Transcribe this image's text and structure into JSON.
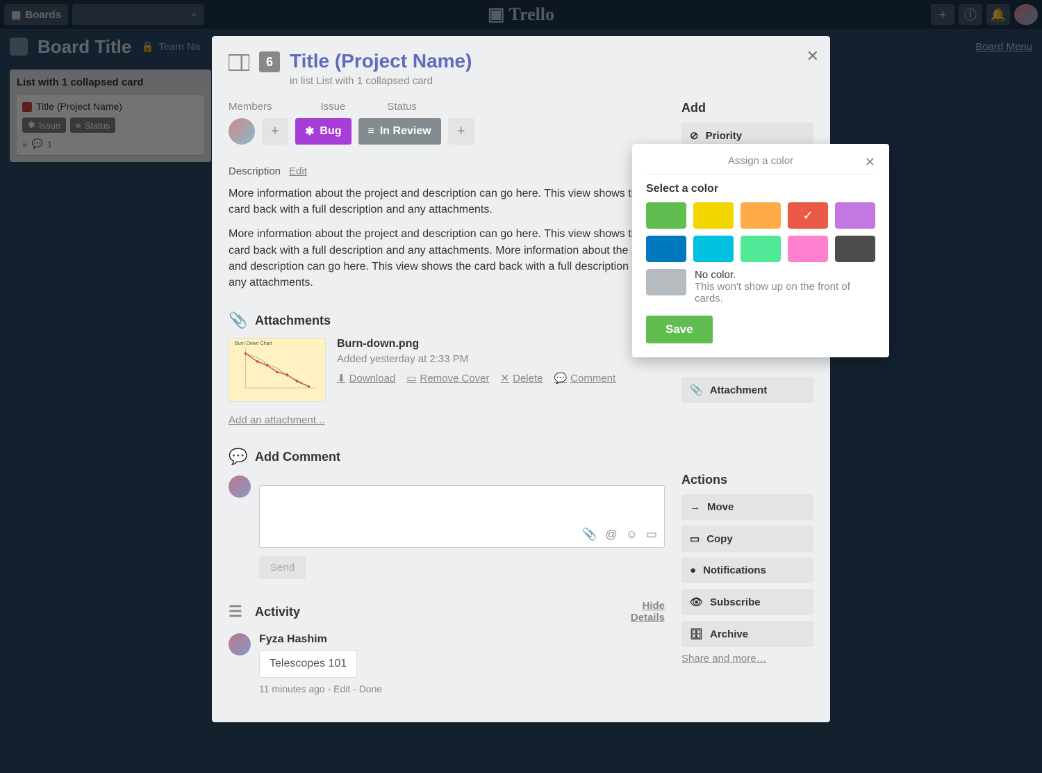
{
  "header": {
    "boards": "Boards",
    "brand": "Trello",
    "board_menu": "Board Menu"
  },
  "board": {
    "title": "Board Title",
    "team": "Team Na"
  },
  "bg_list": {
    "title": "List with 1 collapsed card",
    "card_title": "Title (Project Name)",
    "badge_issue": "Issue",
    "badge_status": "Status",
    "comments": "1"
  },
  "card": {
    "number": "6",
    "title": "Title (Project Name)",
    "subtitle": "in list List with 1 collapsed card",
    "members_label": "Members",
    "issue_label": "Issue",
    "status_label": "Status",
    "tag_bug": "Bug",
    "tag_status": "In Review",
    "desc_label": "Description",
    "edit_link": "Edit",
    "desc1": "More information about the project and description can go here. This view shows the card back with a full description and any attachments.",
    "desc2": "More information about the project and description can go here. This view shows the card back with a full description and any attachments. More information about the project and description can go here. This view shows the card back with a full description and any attachments.",
    "attachments_title": "Attachments",
    "attach": {
      "name": "Burn-down.png",
      "meta": "Added yesterday at 2:33 PM",
      "download": "Download",
      "remove_cover": "Remove Cover",
      "delete": "Delete",
      "comment": "Comment"
    },
    "add_attachment": "Add an attachment...",
    "add_comment_title": "Add Comment",
    "send_label": "Send",
    "activity_title": "Activity",
    "hide": "Hide",
    "details": "Details",
    "activity": {
      "author": "Fyza Hashim",
      "bubble": "Telescopes 101",
      "meta": "11 minutes ago - Edit - Done"
    }
  },
  "sidebar": {
    "add_title": "Add",
    "priority": "Priority",
    "attachment": "Attachment",
    "actions_title": "Actions",
    "move": "Move",
    "copy": "Copy",
    "notifications": "Notifications",
    "subscribe": "Subscribe",
    "archive": "Archive",
    "share": "Share and more…"
  },
  "popover": {
    "title": "Assign a color",
    "subtitle": "Select a color",
    "colors": [
      "#61bd4f",
      "#f2d600",
      "#ffab4a",
      "#eb5a46",
      "#c377e0",
      "#0079bf",
      "#00c2e0",
      "#51e898",
      "#ff80ce",
      "#4d4d4d"
    ],
    "selected_index": 3,
    "nocolor_title": "No color.",
    "nocolor_sub": "This won't show up on the front of cards.",
    "save": "Save"
  }
}
